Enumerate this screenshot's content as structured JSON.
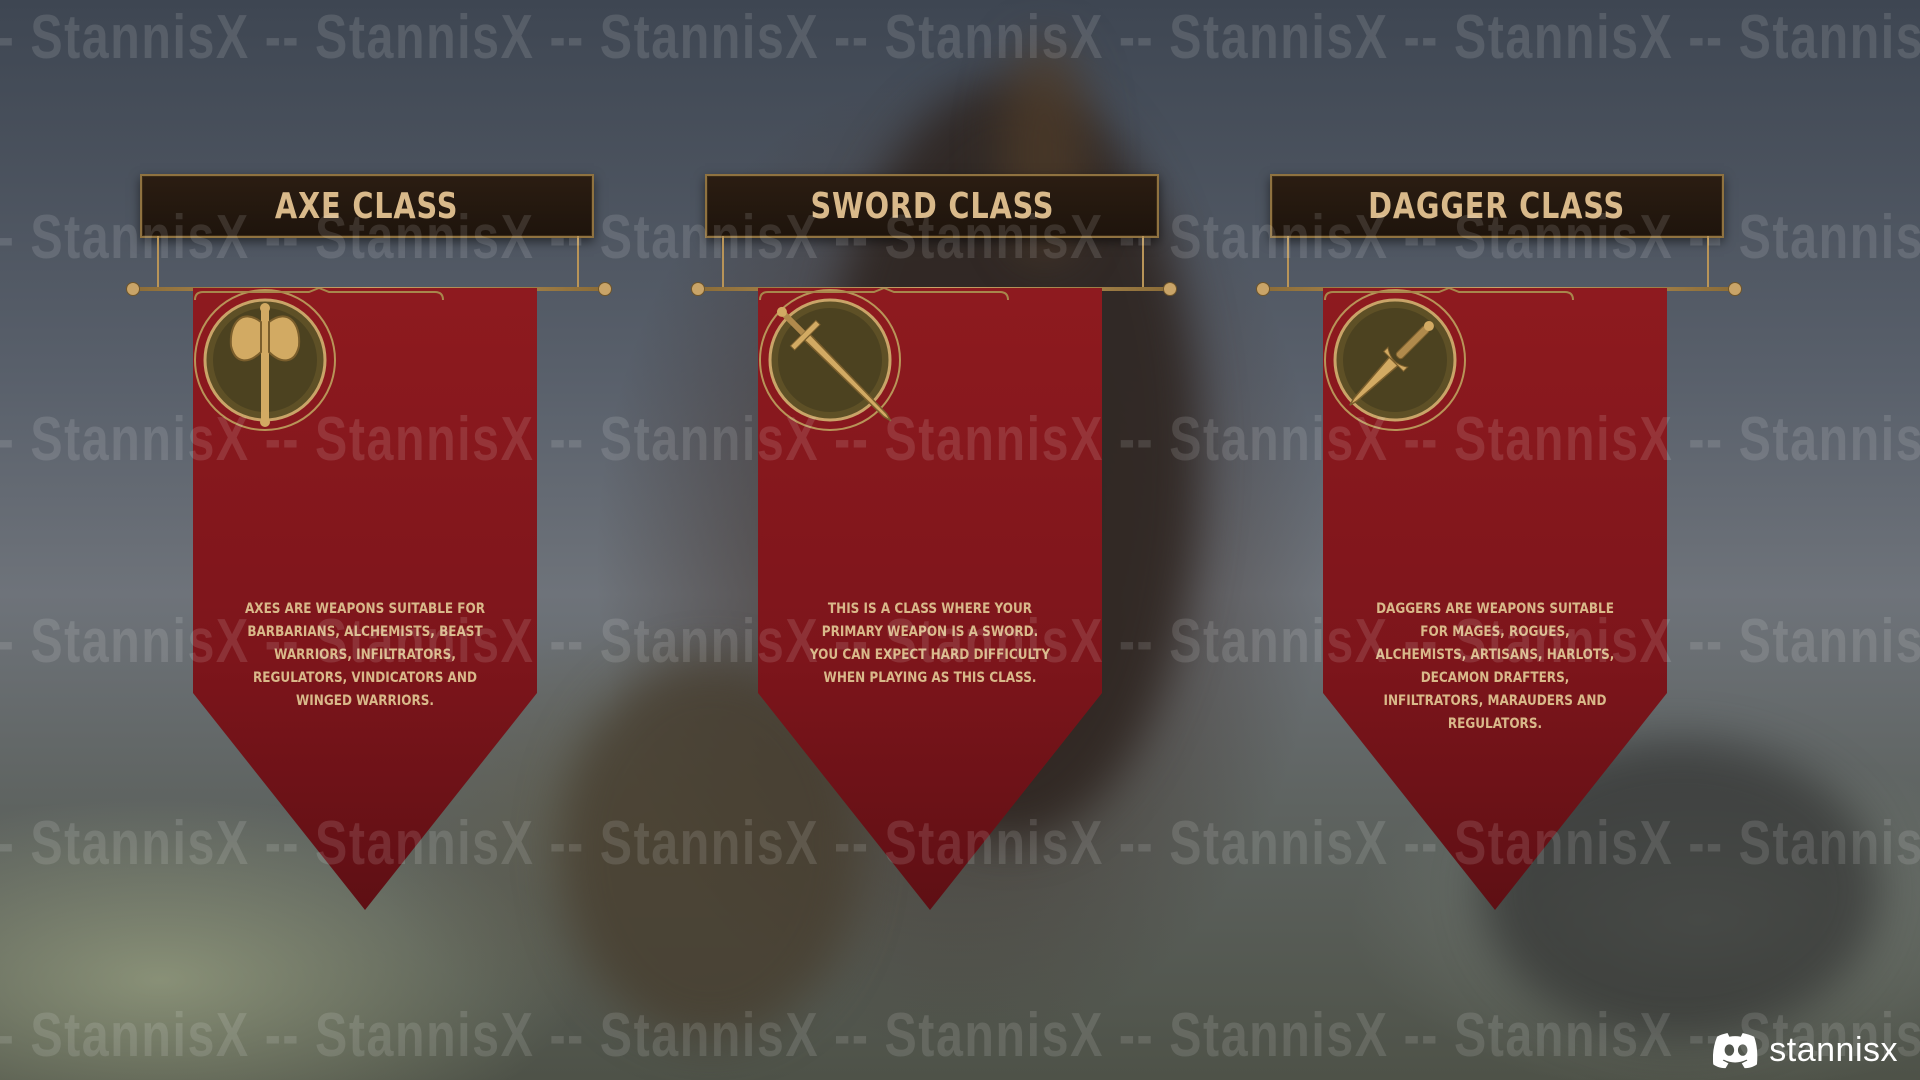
{
  "watermark": {
    "text": "StannisX",
    "separator": "--"
  },
  "cards": [
    {
      "title": "AXE CLASS",
      "description": "Axes are weapons suitable for Barbarians, Alchemists, Beast Warriors, Infiltrators, Regulators, Vindicators and Winged Warriors.",
      "icon": "double-axe-icon"
    },
    {
      "title": "SWORD CLASS",
      "description": "This is a class where your primary weapon is a sword. You can expect hard difficulty when playing as this class.",
      "icon": "sword-icon"
    },
    {
      "title": "DAGGER CLASS",
      "description": "Daggers are weapons suitable for Mages, Rogues, Alchemists, Artisans, Harlots, Decamon Drafters, Infiltrators, Marauders and Regulators.",
      "icon": "dagger-icon"
    }
  ],
  "footer": {
    "icon": "discord-icon",
    "label": "stannisx"
  },
  "colors": {
    "banner_red": "#8e1a1f",
    "gold": "#d9b98a",
    "title_bg": "#231810"
  }
}
